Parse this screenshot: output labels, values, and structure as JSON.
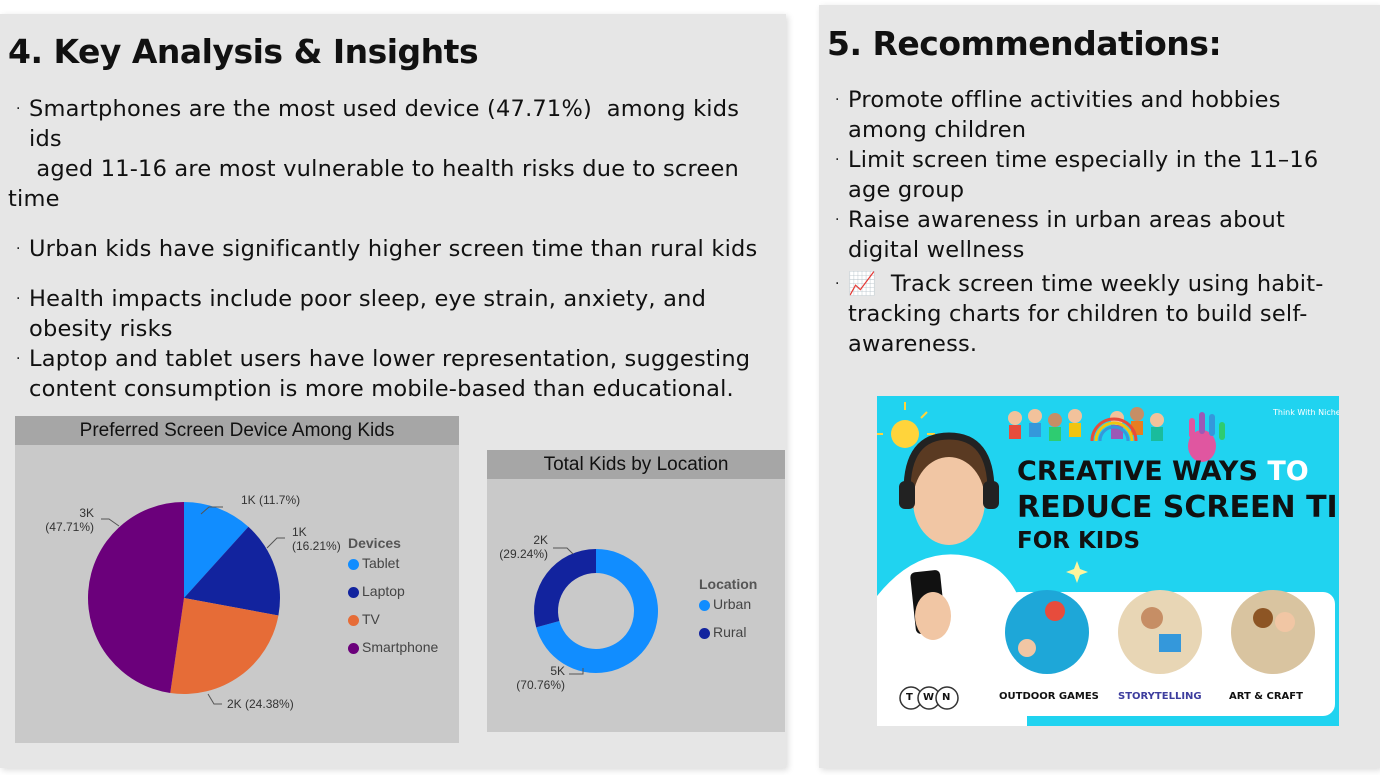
{
  "left": {
    "title": "4. Key Analysis & Insights",
    "bullets": [
      "Smartphones are the most used device (47.71%)  among kids\nids",
      " aged 11-16 are most vulnerable to health risks due to screen",
      "time",
      "Urban kids have significantly higher screen time than rural kids",
      "Health impacts include poor sleep, eye strain, anxiety, and\nobesity risks",
      "Laptop and tablet users have lower representation, suggesting\ncontent consumption is more mobile-based than educational."
    ]
  },
  "right": {
    "title": "5. Recommendations:",
    "bullets": [
      "Promote offline activities and hobbies\namong children",
      "Limit screen time especially in the 11–16\nage group",
      "Raise awareness in urban areas about\ndigital wellness",
      "📈  Track screen time weekly using habit-\ntracking charts for children to build self-\nawareness."
    ]
  },
  "chart_data": [
    {
      "type": "pie",
      "title": "Preferred Screen Device Among Kids",
      "legend_title": "Devices",
      "legend_position": "right",
      "categories": [
        "Tablet",
        "Laptop",
        "TV",
        "Smartphone"
      ],
      "values": [
        11.7,
        16.21,
        24.38,
        47.71
      ],
      "data_labels": [
        "1K (11.7%)",
        "1K\n(16.21%)",
        "2K (24.38%)",
        "3K\n(47.71%)"
      ],
      "colors": [
        "#118dff",
        "#12239e",
        "#e66c37",
        "#6b007b"
      ]
    },
    {
      "type": "donut",
      "title": "Total Kids by Location",
      "legend_title": "Location",
      "legend_position": "right",
      "categories": [
        "Urban",
        "Rural"
      ],
      "values": [
        70.76,
        29.24
      ],
      "data_labels": [
        "5K\n(70.76%)",
        "2K\n(29.24%)"
      ],
      "colors": [
        "#118dff",
        "#12239e"
      ]
    }
  ],
  "promo": {
    "brand": "Think With Niche",
    "headline_1": "CREATIVE WAYS",
    "headline_to": "TO",
    "headline_2": "REDUCE SCREEN TIME",
    "headline_3": "FOR KIDS",
    "captions": [
      "OUTDOOR GAMES",
      "STORYTELLING",
      "ART & CRAFT"
    ],
    "logo_letters": [
      "T",
      "W",
      "N"
    ]
  }
}
